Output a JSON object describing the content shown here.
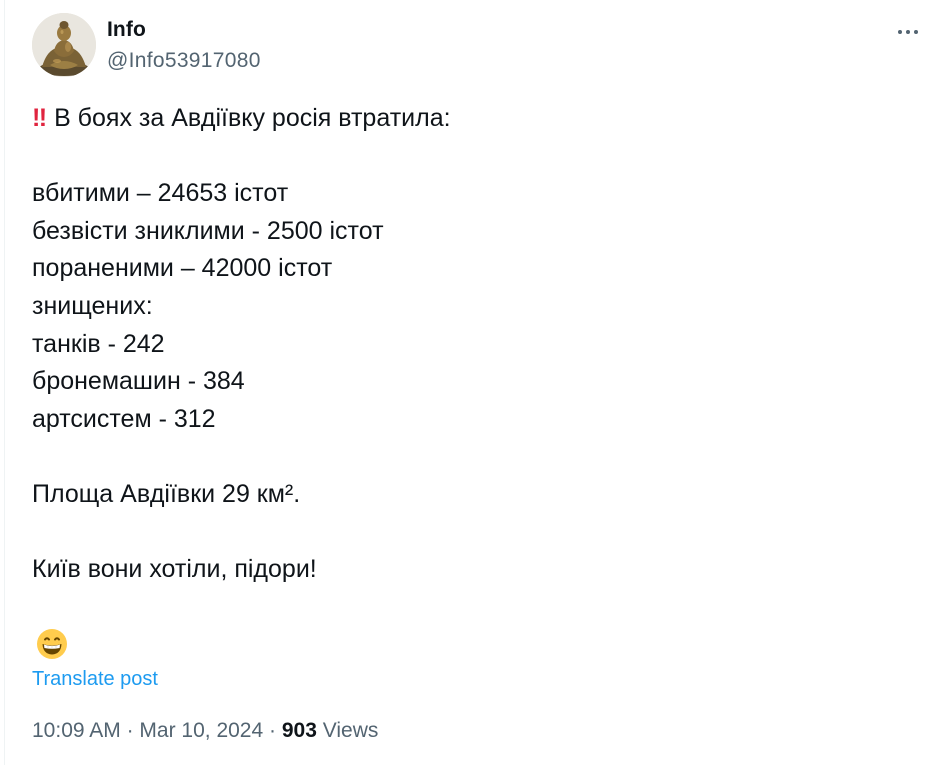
{
  "author": {
    "name": "Info",
    "handle": "@Info53917080"
  },
  "tweet": {
    "alert_emoji": "‼",
    "lines": [
      "В боях за Авдіївку росія втратила:",
      "",
      "вбитими – 24653 істот",
      "безвісти зниклими - 2500 істот",
      "пораненими – 42000 істот",
      "знищених:",
      "танків - 242",
      "бронемашин - 384",
      "артсистем - 312",
      "",
      "Площа Авдіївки 29 км².",
      "",
      "Київ вони хотіли, підори!"
    ],
    "trailing_emoji": "grinning-face-emoji"
  },
  "translate_label": "Translate post",
  "meta": {
    "time": "10:09 AM",
    "separator": "·",
    "date": "Mar 10, 2024",
    "views_count": "903",
    "views_label": "Views"
  },
  "colors": {
    "text": "#0f1419",
    "secondary": "#536471",
    "link": "#1d9bf0",
    "alert": "#e0243f"
  }
}
